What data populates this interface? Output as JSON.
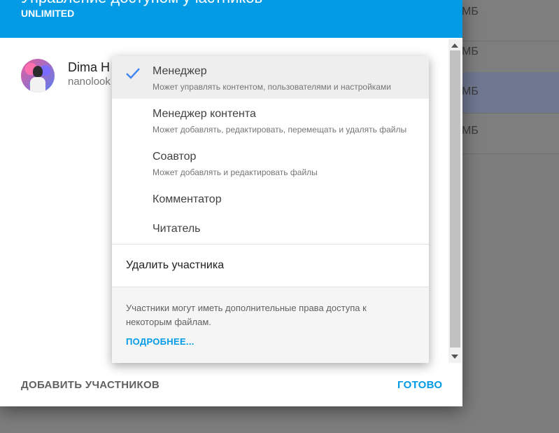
{
  "background": {
    "sizes": [
      "МБ",
      "МБ",
      "МБ",
      "МБ"
    ]
  },
  "dialog": {
    "title": "Управление доступом участников",
    "subtitle": "UNLIMITED",
    "user": {
      "name": "Dima H",
      "email": "nanolook"
    },
    "footer": {
      "add_label": "ДОБАВИТЬ УЧАСТНИКОВ",
      "done_label": "ГОТОВО"
    }
  },
  "menu": {
    "roles": [
      {
        "label": "Менеджер",
        "description": "Может управлять контентом, пользователями и настройками",
        "selected": true
      },
      {
        "label": "Менеджер контента",
        "description": "Может добавлять, редактировать, перемещать и удалять файлы",
        "selected": false
      },
      {
        "label": "Соавтор",
        "description": "Может добавлять и редактировать файлы",
        "selected": false
      },
      {
        "label": "Комментатор",
        "description": "",
        "selected": false
      },
      {
        "label": "Читатель",
        "description": "",
        "selected": false
      }
    ],
    "remove_label": "Удалить участника",
    "info_text": "Участники могут иметь дополнительные права доступа к некоторым файлам.",
    "info_link": "ПОДРОБНЕЕ..."
  },
  "colors": {
    "accent": "#039be5",
    "check": "#4285f4"
  }
}
